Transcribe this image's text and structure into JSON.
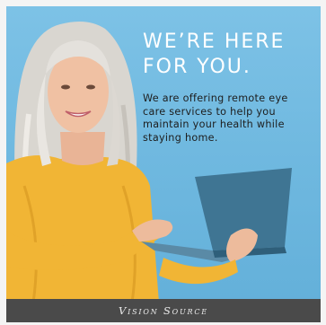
{
  "headline": {
    "line1": "WE’RE HERE",
    "line2": "FOR YOU."
  },
  "body_text": "We are offering remote eye care services to help you maintain your health while staying home.",
  "footer": {
    "logo": "Vision Source"
  },
  "colors": {
    "background": "#70b9e0",
    "headline": "#ffffff",
    "body": "#1d1d1d",
    "sweater": "#f1b535",
    "laptop": "#3f7593",
    "footer": "#4a4a4a"
  }
}
